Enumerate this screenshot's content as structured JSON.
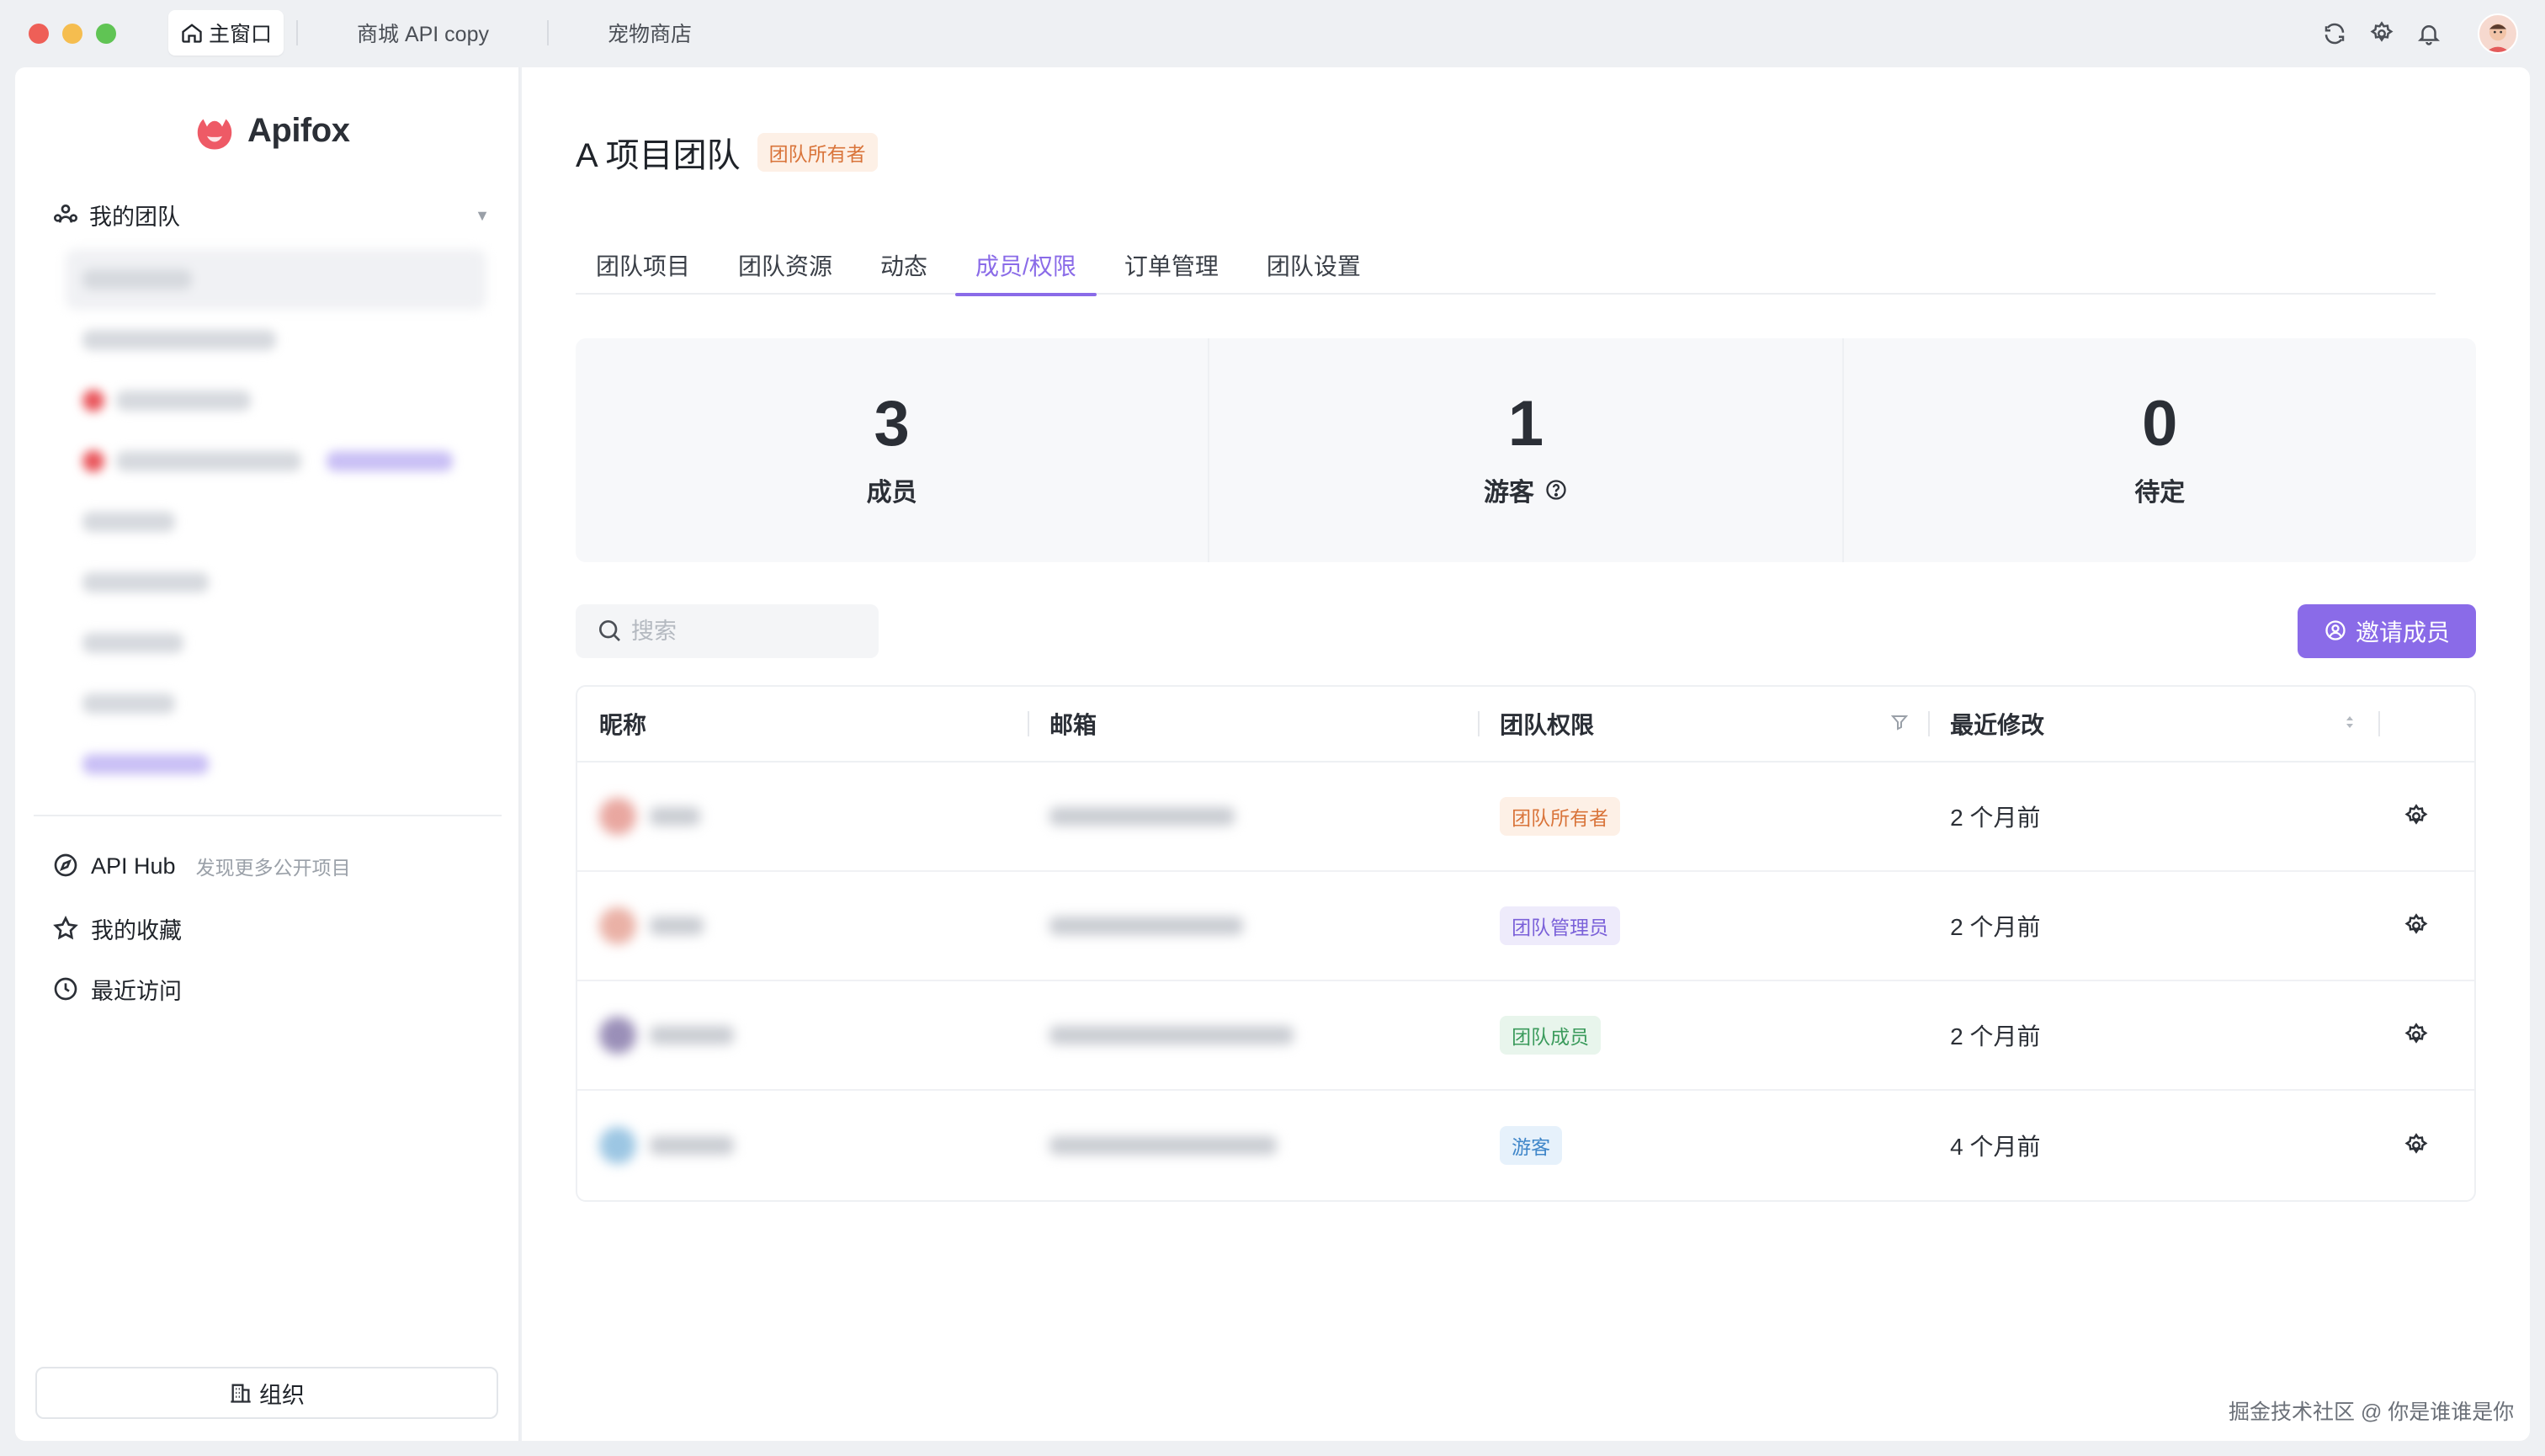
{
  "window": {
    "tabs": [
      {
        "label": "主窗口",
        "active": true
      },
      {
        "label": "商城 API copy",
        "active": false
      },
      {
        "label": "宠物商店",
        "active": false
      }
    ],
    "icons": [
      "refresh-icon",
      "settings-icon",
      "bell-icon",
      "user-avatar"
    ]
  },
  "sidebar": {
    "logo_text": "Apifox",
    "team_selector": "我的团队",
    "nav": [
      {
        "label": "API Hub",
        "hint": "发现更多公开项目",
        "icon": "compass-icon"
      },
      {
        "label": "我的收藏",
        "icon": "star-icon"
      },
      {
        "label": "最近访问",
        "icon": "clock-icon"
      }
    ],
    "org_button": "组织"
  },
  "header": {
    "title": "A 项目团队",
    "role_badge": "团队所有者"
  },
  "tabs": [
    {
      "label": "团队项目"
    },
    {
      "label": "团队资源"
    },
    {
      "label": "动态"
    },
    {
      "label": "成员/权限",
      "active": true
    },
    {
      "label": "订单管理"
    },
    {
      "label": "团队设置"
    }
  ],
  "stats": [
    {
      "value": "3",
      "label": "成员"
    },
    {
      "value": "1",
      "label": "游客"
    },
    {
      "value": "0",
      "label": "待定"
    }
  ],
  "search": {
    "placeholder": "搜索",
    "value": ""
  },
  "invite_button": "邀请成员",
  "table": {
    "columns": [
      "昵称",
      "邮箱",
      "团队权限",
      "最近修改"
    ],
    "rows": [
      {
        "role": "团队所有者",
        "role_type": "owner",
        "modified": "2 个月前"
      },
      {
        "role": "团队管理员",
        "role_type": "admin",
        "modified": "2 个月前"
      },
      {
        "role": "团队成员",
        "role_type": "member",
        "modified": "2 个月前"
      },
      {
        "role": "游客",
        "role_type": "guest",
        "modified": "4 个月前"
      }
    ]
  },
  "watermark": "掘金技术社区 @ 你是谁谁是你",
  "colors": {
    "accent": "#8a6be8",
    "owner_badge": "#d9743a",
    "admin_badge": "#7b61d9",
    "member_badge": "#3b9b5c",
    "guest_badge": "#3f86c9"
  }
}
